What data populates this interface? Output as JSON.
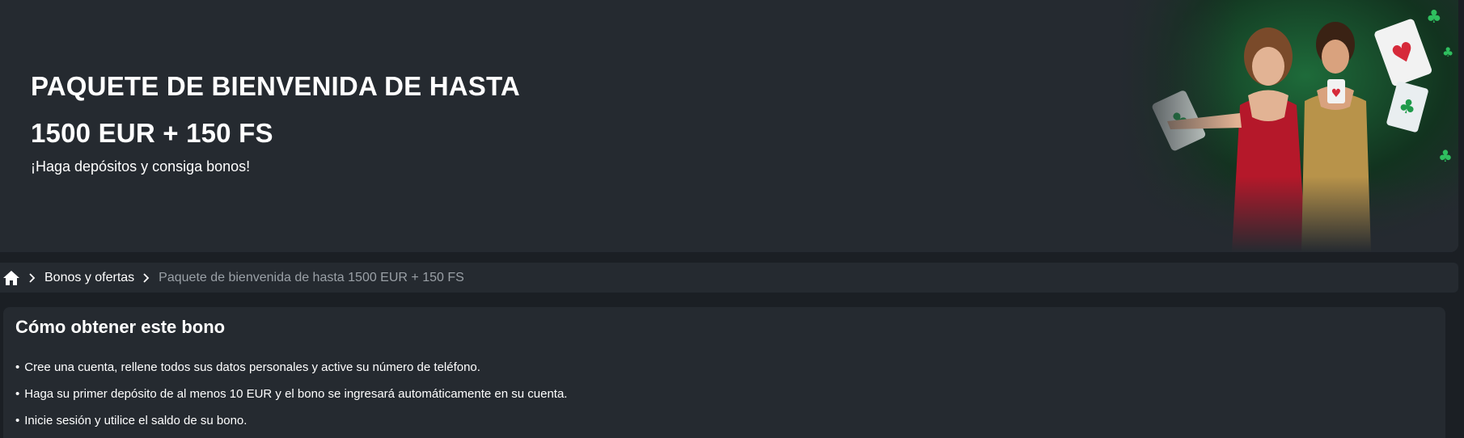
{
  "banner": {
    "title_line1": "PAQUETE DE BIENVENIDA DE HASTA",
    "title_line2": "1500 EUR + 150 FS",
    "subtitle": "¡Haga depósitos y consiga bonos!",
    "image": "casino-dealers-with-cards"
  },
  "breadcrumb": {
    "home_icon": "home-icon",
    "separator_icon": "chevron-right-icon",
    "items": [
      {
        "label": "Bonos y ofertas"
      },
      {
        "label": "Paquete de bienvenida de hasta 1500 EUR + 150 FS"
      }
    ]
  },
  "bonus_card": {
    "title": "Cómo obtener este bono",
    "steps": [
      "Cree una cuenta, rellene todos sus datos personales y active su número de teléfono.",
      "Haga su primer depósito de al menos 10 EUR y el bono se ingresará automáticamente en su cuenta.",
      "Inicie sesión y utilice el saldo de su bono."
    ]
  },
  "colors": {
    "page_bg": "#1b1f24",
    "panel_bg": "#252a30",
    "text": "#ffffff",
    "muted_text": "#9aa0a6",
    "accent_green": "#1f7a3f",
    "dress_red": "#b5182a",
    "dress_gold": "#b8934a"
  }
}
